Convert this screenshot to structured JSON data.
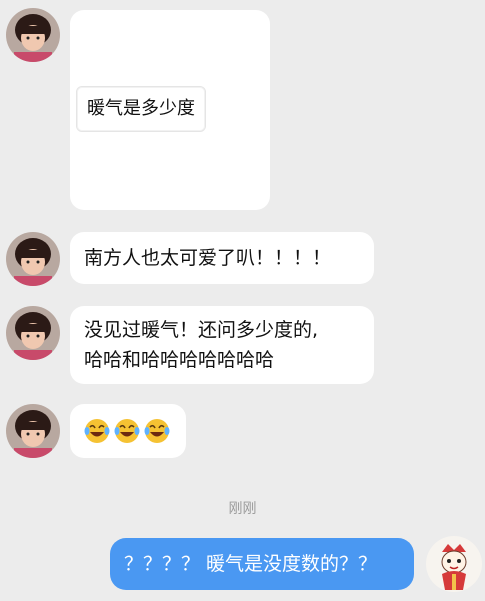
{
  "messages": {
    "m1_card_text": "暖气是多少度",
    "m2_text": "南方人也太可爱了叭！！！！",
    "m3_line1": "没见过暖气！还问多少度的,",
    "m3_line2": "哈哈和哈哈哈哈哈哈哈",
    "m4_emojis": [
      "laughing-tears-emoji",
      "laughing-tears-emoji",
      "laughing-tears-emoji"
    ],
    "timestamp": "刚刚",
    "m5_text": "？？？？ 暖气是没度数的？？"
  },
  "colors": {
    "background": "#ececec",
    "incoming_bubble": "#ffffff",
    "outgoing_bubble": "#4a98f2",
    "timestamp": "#9a9a9a"
  }
}
